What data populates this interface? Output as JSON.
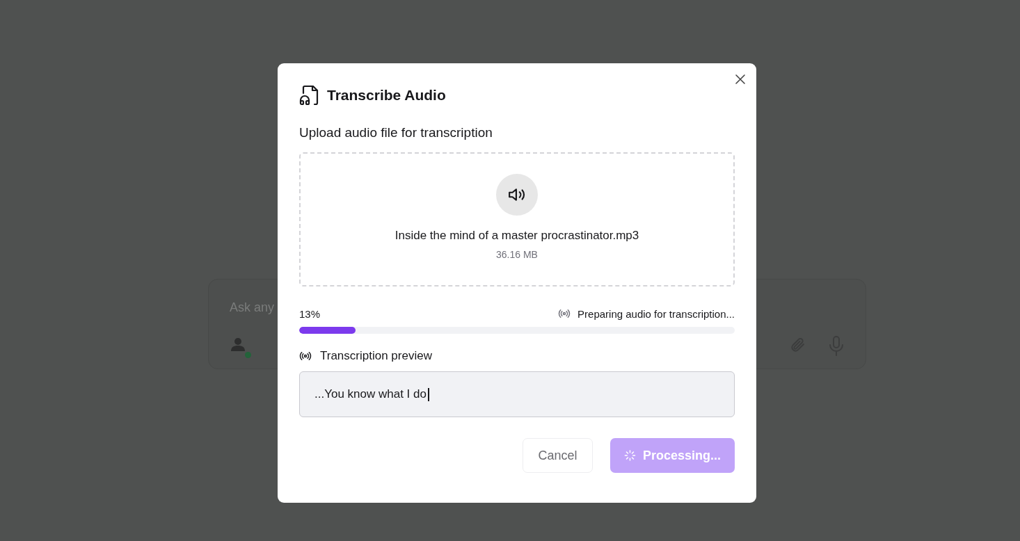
{
  "background_chat": {
    "placeholder": "Ask any"
  },
  "dialog": {
    "title": "Transcribe Audio",
    "subtitle": "Upload audio file for transcription",
    "file": {
      "name": "Inside the mind of a master procrastinator.mp3",
      "size": "36.16 MB"
    },
    "progress": {
      "percent": "13%",
      "level": 0.13,
      "status": "Preparing audio for transcription..."
    },
    "preview": {
      "label": "Transcription preview",
      "value": "...You know what I do"
    },
    "buttons": [
      {
        "label": "Cancel",
        "kind": "secondary",
        "disabled": false
      },
      {
        "label": "Processing...",
        "kind": "primary",
        "disabled": true
      }
    ]
  }
}
